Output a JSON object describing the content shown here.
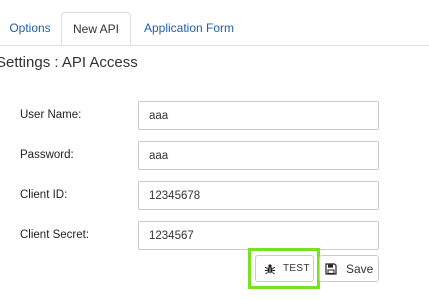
{
  "tabs": [
    {
      "label": "Options"
    },
    {
      "label": "New API"
    },
    {
      "label": "Application Form"
    }
  ],
  "section": {
    "title": "Settings : API Access"
  },
  "form": {
    "user_name": {
      "label": "User Name:",
      "value": "aaa"
    },
    "password": {
      "label": "Password:",
      "value": "aaa"
    },
    "client_id": {
      "label": "Client ID:",
      "value": "12345678"
    },
    "client_secret": {
      "label": "Client Secret:",
      "value": "1234567"
    }
  },
  "actions": {
    "test_label": "TEST",
    "test_icon": "bug-icon",
    "save_label": "Save",
    "save_icon": "floppy-disk-icon"
  },
  "colors": {
    "tab_link": "#1f5fa8",
    "highlight": "#7ae120"
  }
}
